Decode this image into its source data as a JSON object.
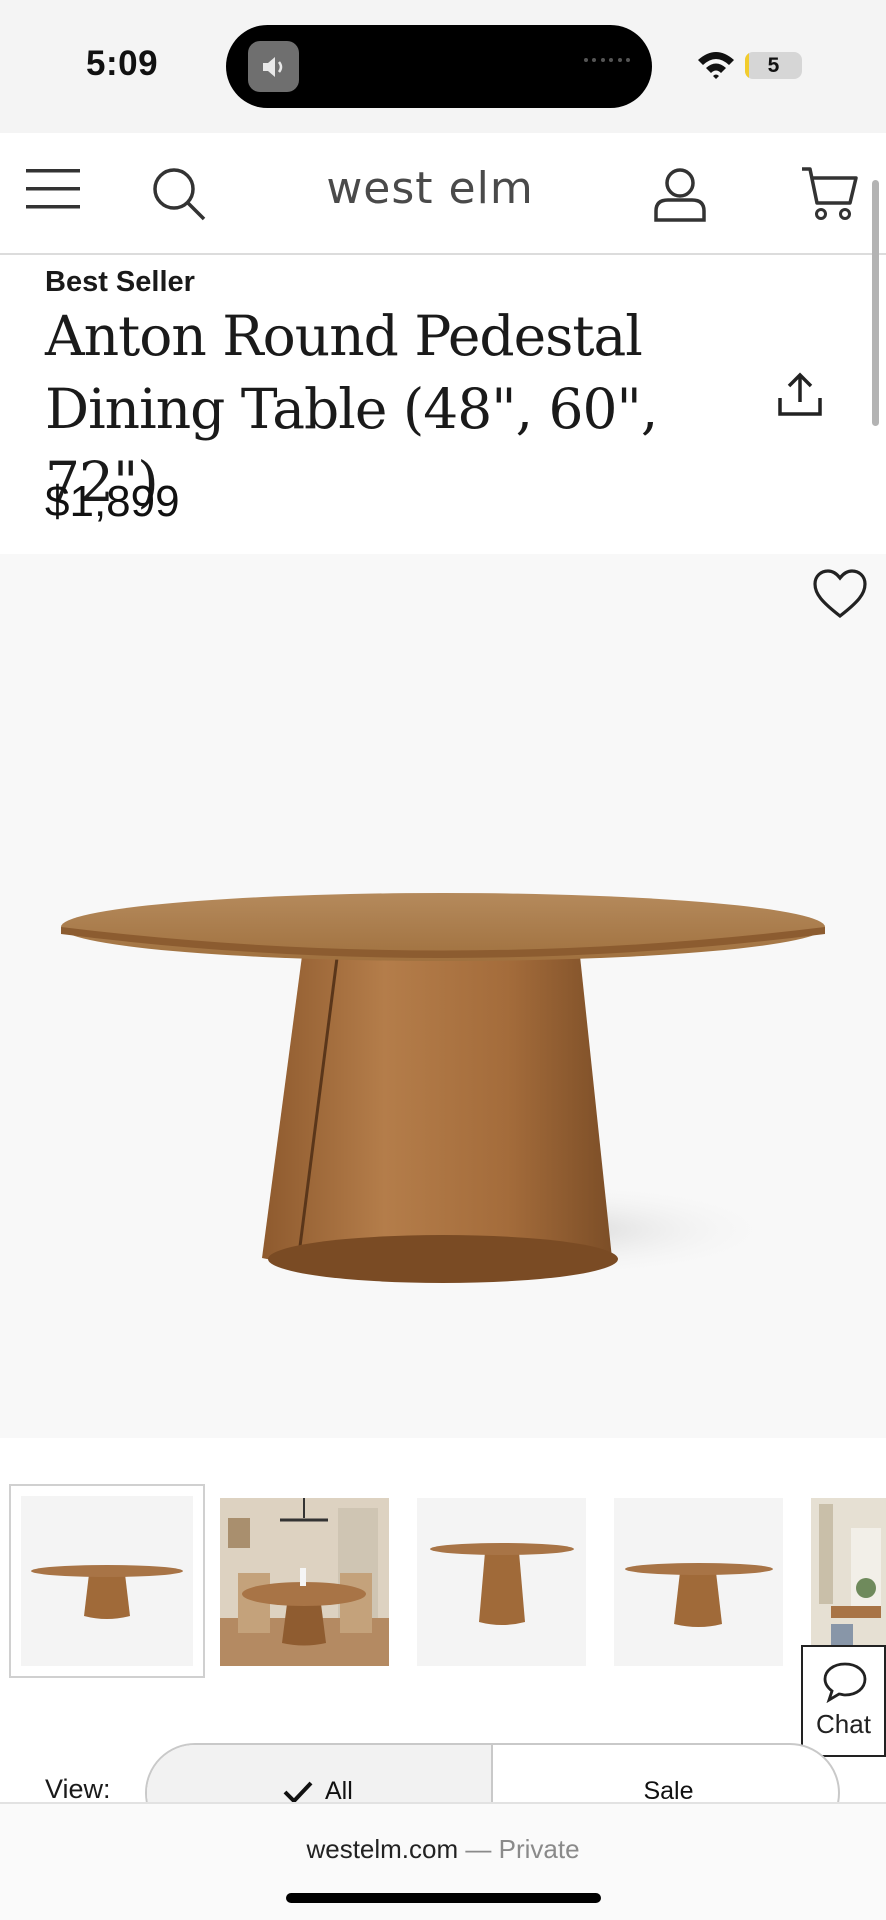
{
  "status_bar": {
    "time": "5:09",
    "battery_level": "5",
    "battery_fraction": 0.05
  },
  "header": {
    "logo": "west elm",
    "menu_icon": "hamburger-menu-icon",
    "search_icon": "search-icon",
    "account_icon": "account-icon",
    "cart_icon": "cart-icon"
  },
  "product": {
    "badge": "Best Seller",
    "title": "Anton Round Pedestal Dining Table (48\", 60\", 72\")",
    "price": "$1,899",
    "share_icon": "share-icon",
    "favorite_icon": "heart-icon",
    "wood_color": "#a87446"
  },
  "gallery": {
    "thumbnails": [
      {
        "name": "thumb-table-front",
        "selected": true
      },
      {
        "name": "thumb-dining-room",
        "selected": false
      },
      {
        "name": "thumb-table-small",
        "selected": false
      },
      {
        "name": "thumb-table-wide",
        "selected": false
      },
      {
        "name": "thumb-room-partial",
        "selected": false
      }
    ]
  },
  "chat": {
    "label": "Chat",
    "icon": "chat-bubble-icon"
  },
  "view_filter": {
    "label": "View:",
    "options": [
      "All",
      "Sale"
    ],
    "selected": "All"
  },
  "browser": {
    "host": "westelm.com",
    "separator": " — ",
    "mode": "Private"
  }
}
